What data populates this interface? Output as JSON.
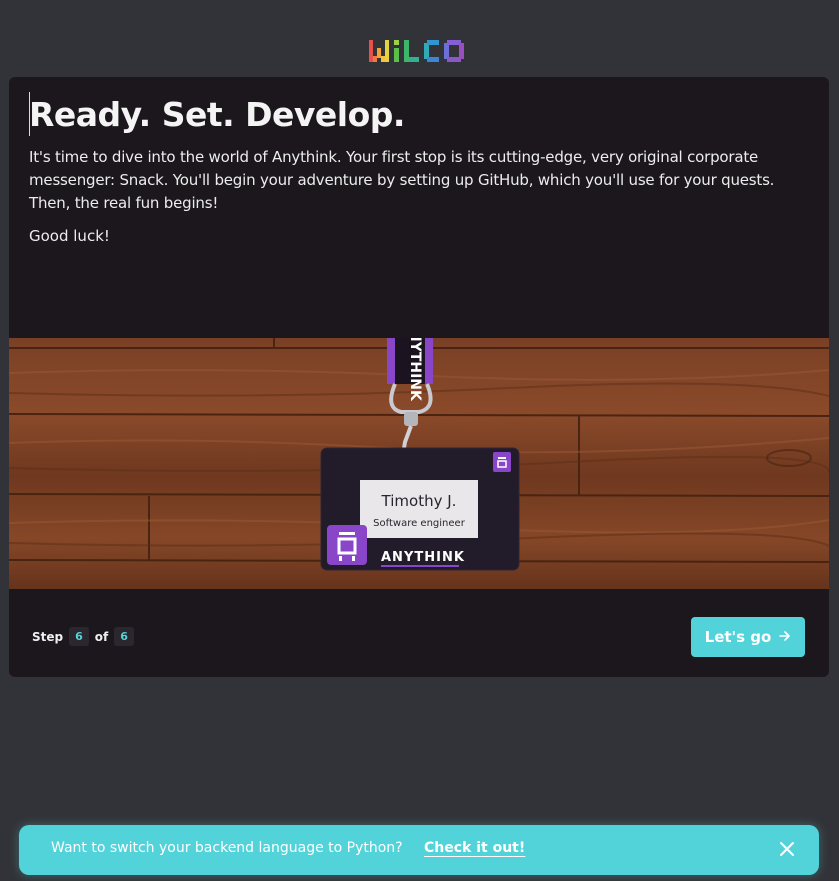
{
  "logo": {
    "text": "WiLCO"
  },
  "intro": {
    "title": "Ready. Set. Develop.",
    "description": "It's time to dive into the world of Anythink. Your first stop is its cutting-edge, very original corporate messenger: Snack. You'll begin your adventure by setting up GitHub, which you'll use for your quests. Then, the real fun begins!",
    "closing": "Good luck!"
  },
  "badge": {
    "name": "Timothy J.",
    "role": "Software engineer",
    "company": "ANYTHINK",
    "lanyard_text": "ANYTHINK"
  },
  "progress": {
    "step_label": "Step",
    "current": "6",
    "of_label": "of",
    "total": "6"
  },
  "actions": {
    "go_label": "Let's go",
    "go_icon": "arrow-right-icon"
  },
  "banner": {
    "text": "Want to switch your backend language to Python?",
    "link": "Check it out!",
    "close_icon": "close-icon"
  },
  "colors": {
    "background": "#323338",
    "card": "#1b171d",
    "accent": "#52d3da",
    "badge_purple": "#8a46c9"
  }
}
